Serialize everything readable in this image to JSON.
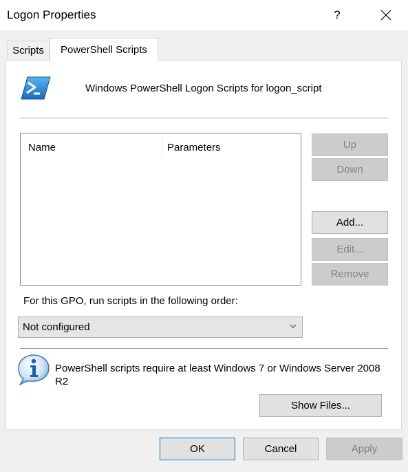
{
  "window": {
    "title": "Logon Properties",
    "help_label": "?"
  },
  "tabs": [
    {
      "label": "Scripts"
    },
    {
      "label": "PowerShell Scripts"
    }
  ],
  "header": {
    "text": "Windows PowerShell Logon Scripts for logon_script",
    "icon": "powershell-icon"
  },
  "scripts_list": {
    "columns": [
      "Name",
      "Parameters"
    ],
    "rows": []
  },
  "side_buttons": {
    "up": "Up",
    "down": "Down",
    "add": "Add...",
    "edit": "Edit...",
    "remove": "Remove"
  },
  "order": {
    "label": "For this GPO, run scripts in the following order:",
    "selected": "Not configured"
  },
  "info": {
    "text": "PowerShell scripts require at least Windows 7 or Windows Server 2008 R2",
    "icon": "info-icon"
  },
  "show_files_label": "Show Files...",
  "footer": {
    "ok": "OK",
    "cancel": "Cancel",
    "apply": "Apply"
  },
  "colors": {
    "accent": "#0078d7",
    "powershell_blue": "#2a7fd0",
    "disabled_text": "#838383"
  }
}
